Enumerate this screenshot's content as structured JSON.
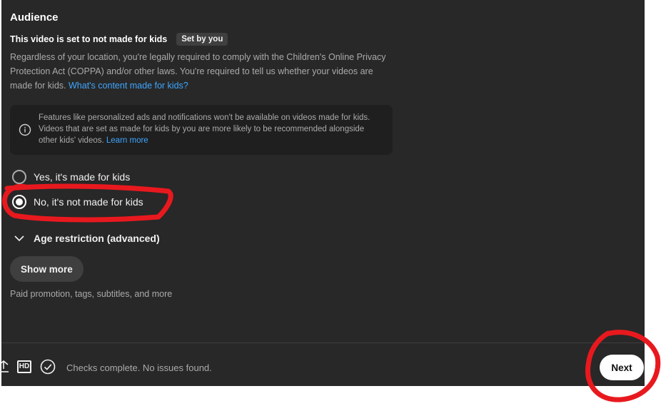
{
  "audience": {
    "title": "Audience",
    "subtitle": "This video is set to not made for kids",
    "badge": "Set by you",
    "description": "Regardless of your location, you're legally required to comply with the Children's Online Privacy Protection Act (COPPA) and/or other laws. You're required to tell us whether your videos are made for kids.",
    "link": "What's content made for kids?"
  },
  "info_box": {
    "text": "Features like personalized ads and notifications won't be available on videos made for kids. Videos that are set as made for kids by you are more likely to be recommended alongside other kids' videos.",
    "link": "Learn more",
    "icon": "info-icon"
  },
  "options": [
    {
      "label": "Yes, it's made for kids",
      "selected": false
    },
    {
      "label": "No, it's not made for kids",
      "selected": true
    }
  ],
  "age_restriction": {
    "label": "Age restriction (advanced)",
    "icon": "chevron-down-icon"
  },
  "show_more": {
    "label": "Show more",
    "description": "Paid promotion, tags, subtitles, and more"
  },
  "footer": {
    "hd_label": "HD",
    "status": "Checks complete. No issues found.",
    "next_label": "Next"
  },
  "colors": {
    "panel_bg": "#282828",
    "link": "#3ea6ff",
    "annotation": "#e8191e"
  }
}
